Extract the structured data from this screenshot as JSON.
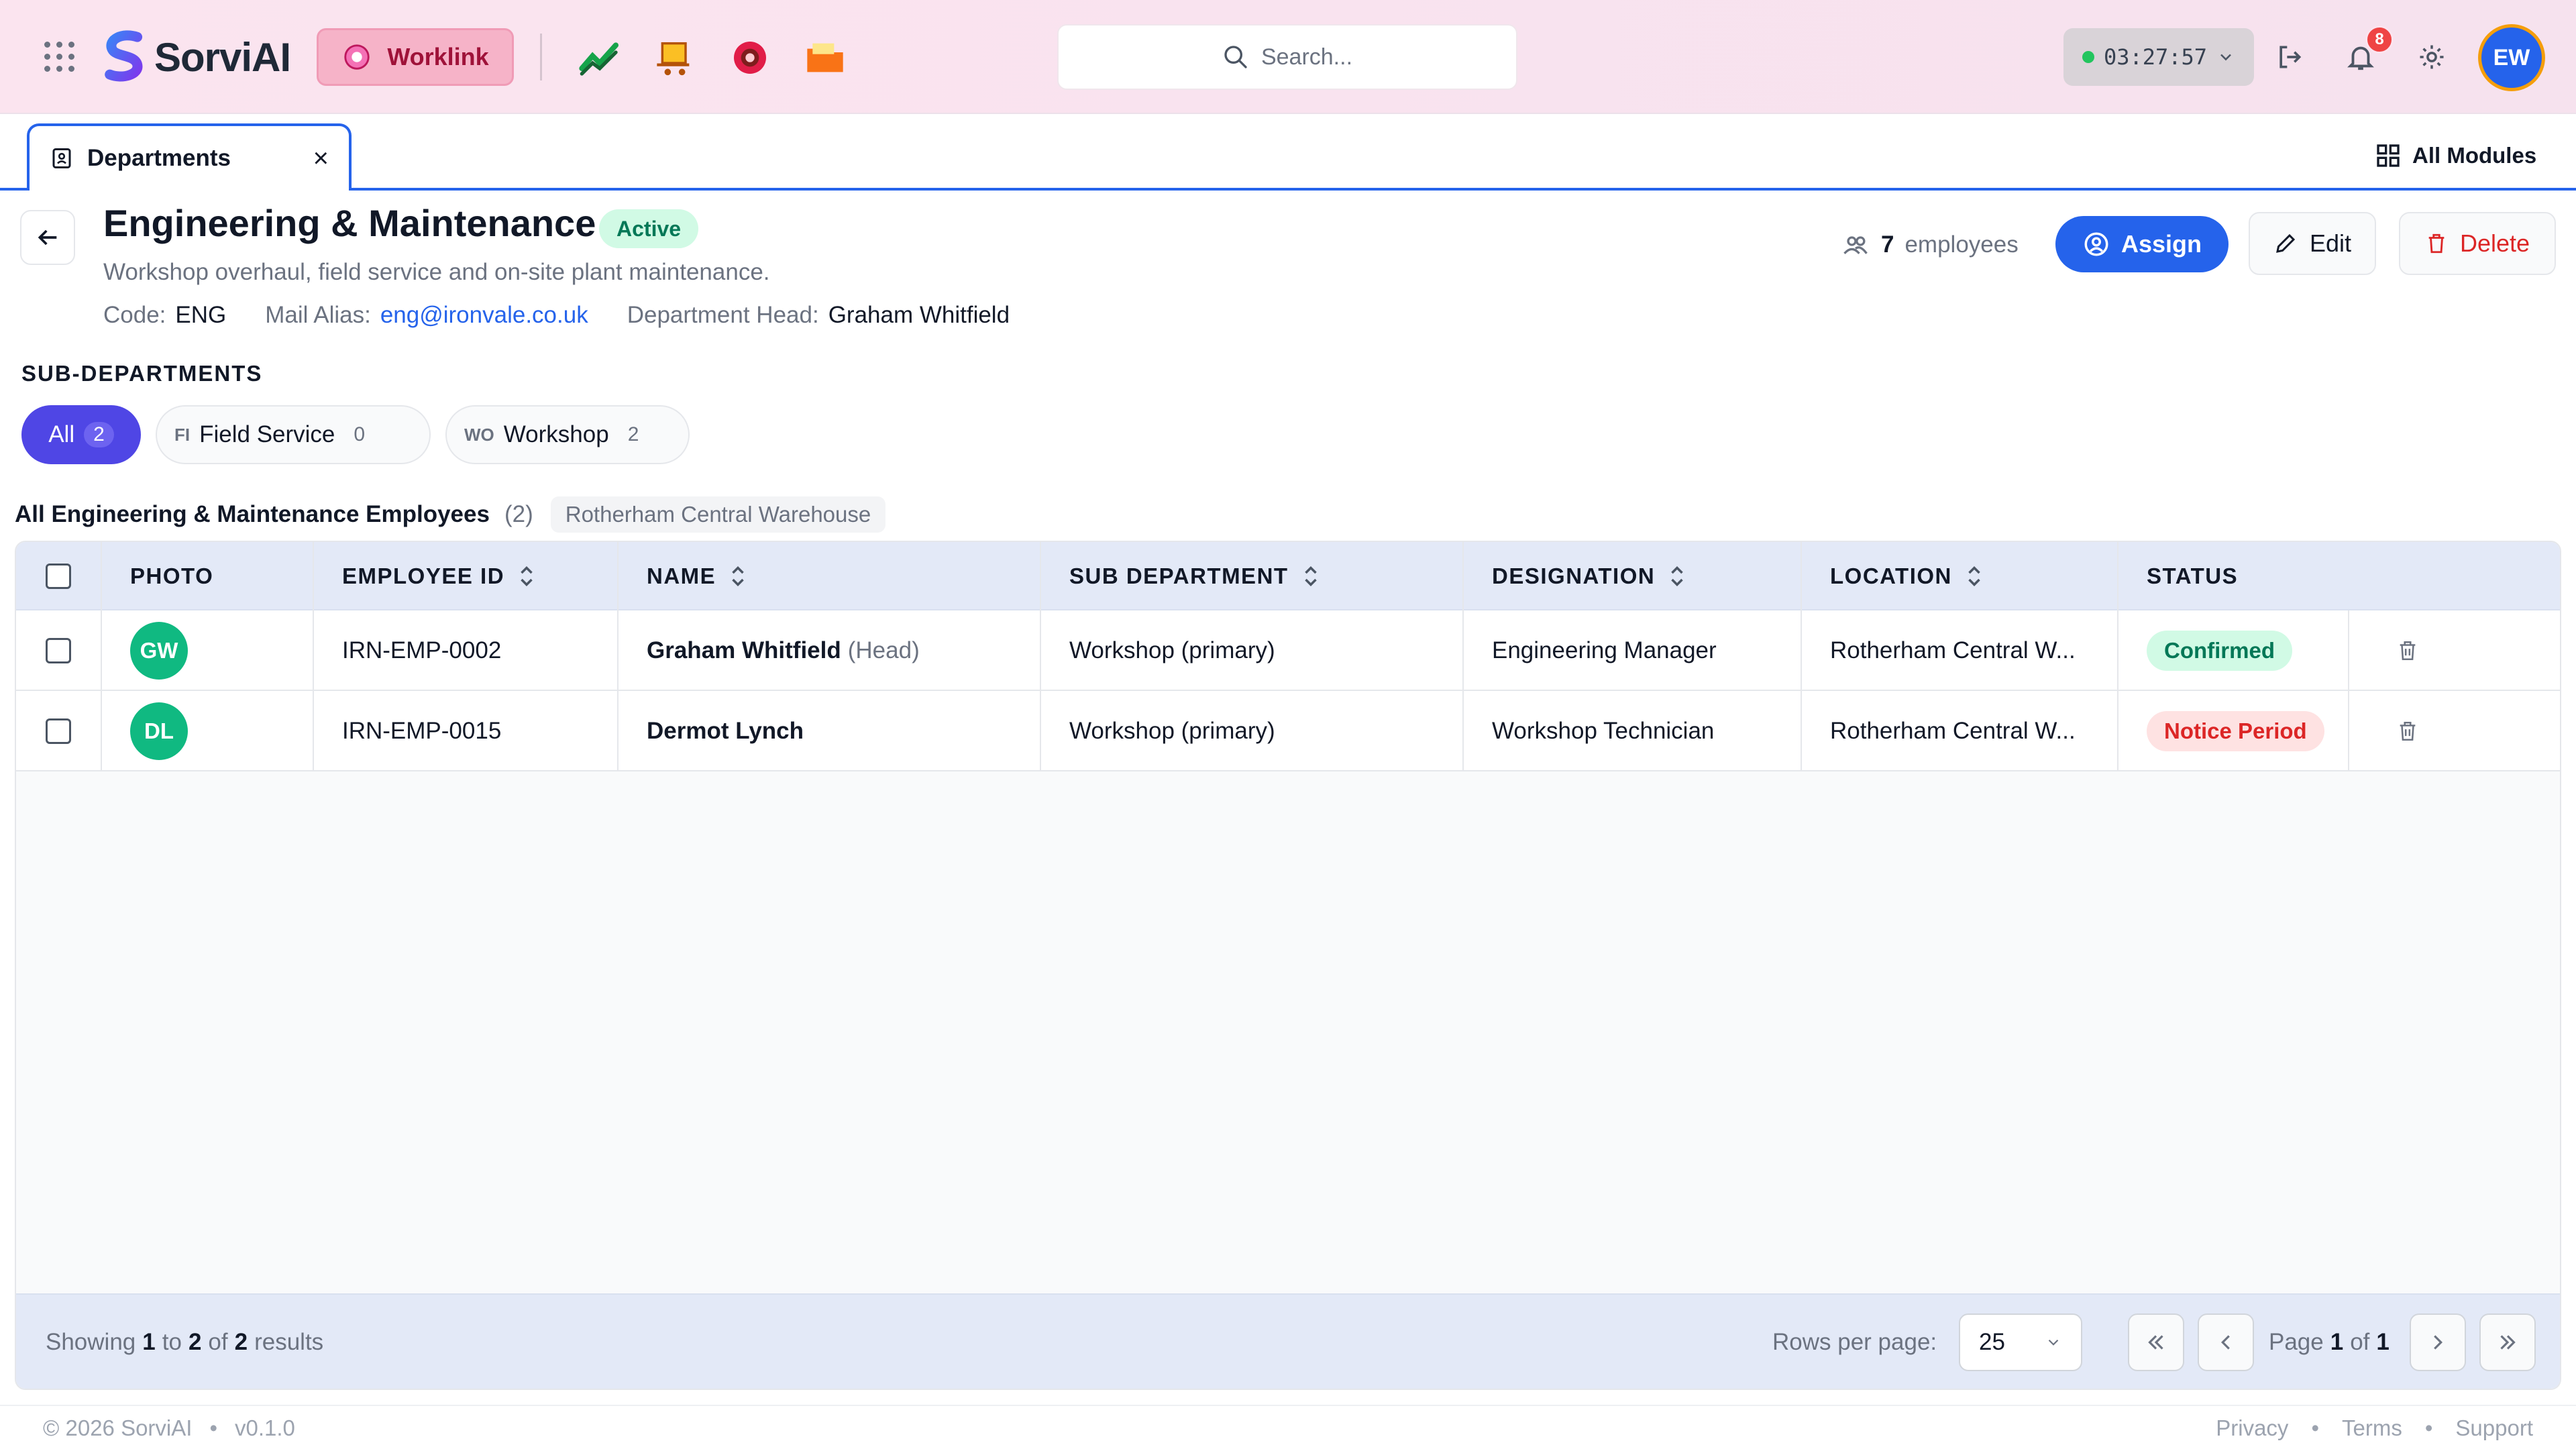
{
  "app": {
    "brand": "SorviAI",
    "module": "Worklink",
    "search_placeholder": "Search...",
    "timer": "03:27:57",
    "notifications": "8",
    "user_initials": "EW"
  },
  "tabs": {
    "active": "Departments",
    "all_modules": "All Modules"
  },
  "department": {
    "title": "Engineering & Maintenance",
    "status": "Active",
    "description": "Workshop overhaul, field service and on-site plant maintenance.",
    "code_label": "Code:",
    "code": "ENG",
    "mail_label": "Mail Alias:",
    "mail": "eng@ironvale.co.uk",
    "head_label": "Department Head:",
    "head": "Graham Whitfield",
    "employee_count": "7",
    "employee_word": "employees",
    "assign": "Assign",
    "edit": "Edit",
    "delete": "Delete"
  },
  "subdepartments": {
    "heading": "SUB-DEPARTMENTS",
    "chips": [
      {
        "abbr": "",
        "label": "All",
        "count": "2"
      },
      {
        "abbr": "FI",
        "label": "Field Service",
        "count": "0"
      },
      {
        "abbr": "WO",
        "label": "Workshop",
        "count": "2"
      }
    ]
  },
  "list": {
    "title": "All Engineering & Maintenance Employees",
    "count": "(2)",
    "location_chip": "Rotherham Central Warehouse"
  },
  "table": {
    "columns": [
      "PHOTO",
      "EMPLOYEE ID",
      "NAME",
      "SUB DEPARTMENT",
      "DESIGNATION",
      "LOCATION",
      "STATUS"
    ],
    "rows": [
      {
        "initials": "GW",
        "id": "IRN-EMP-0002",
        "name": "Graham Whitfield",
        "tag": "(Head)",
        "sub": "Workshop (primary)",
        "designation": "Engineering Manager",
        "location": "Rotherham Central W...",
        "status": "Confirmed"
      },
      {
        "initials": "DL",
        "id": "IRN-EMP-0015",
        "name": "Dermot Lynch",
        "tag": "",
        "sub": "Workshop (primary)",
        "designation": "Workshop Technician",
        "location": "Rotherham Central W...",
        "status": "Notice Period"
      }
    ]
  },
  "pagination": {
    "showing": "Showing",
    "from": "1",
    "to_word": "to",
    "to": "2",
    "of_word": "of",
    "total": "2",
    "results_word": "results",
    "rows_per_page_label": "Rows per page:",
    "rows_per_page": "25",
    "page_word": "Page",
    "page": "1",
    "page_of": "of",
    "pages": "1"
  },
  "footer": {
    "copyright": "© 2026 SorviAI",
    "version": "v0.1.0",
    "links": [
      "Privacy",
      "Terms",
      "Support"
    ]
  },
  "colors": {
    "accent": "#2563eb",
    "chip_active": "#4f46e5",
    "avatar": "#10b981",
    "status_confirmed": "#047857",
    "status_notice": "#dc2626"
  },
  "icons": [
    "apps-grid-icon",
    "logo-icon",
    "worklink-icon",
    "trend-icon",
    "box-cart-icon",
    "gear-settings-app-icon",
    "folder-icon",
    "search-icon",
    "status-dot-icon",
    "chevron-down-icon",
    "logout-icon",
    "bell-icon",
    "gear-icon",
    "department-icon",
    "close-icon",
    "all-modules-icon",
    "back-arrow-icon",
    "people-icon",
    "assign-icon",
    "pencil-icon",
    "trash-icon",
    "sort-icon"
  ]
}
